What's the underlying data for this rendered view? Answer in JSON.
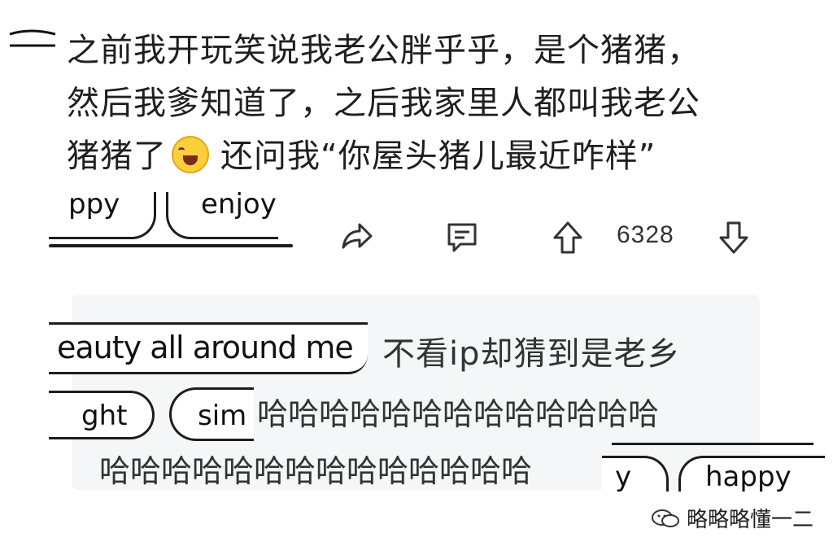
{
  "post": {
    "lines": [
      "之前我开玩笑说我老公胖乎乎，是个猪猪，",
      "然后我爹知道了，之后我家里人都叫我老公",
      "猪猪了",
      "还问我“你屋头猪儿最近咋样”"
    ],
    "emoji": "laughing-crying-emoji"
  },
  "overlay_fragments": {
    "pill_a": "ppy",
    "pill_b": "enjoy",
    "pill_c": "eauty all around me",
    "pill_d": "ght",
    "pill_e": "sim",
    "pill_f": "y",
    "pill_g": "happy"
  },
  "actions": {
    "share_icon": "share-icon",
    "comment_icon": "comment-icon",
    "upvote_icon": "upvote-icon",
    "downvote_icon": "downvote-icon",
    "vote_count": "6328"
  },
  "reply": {
    "line1": "不看ip却猜到是老乡",
    "line2": "哈哈哈哈哈哈哈哈哈哈哈哈哈",
    "line3": "哈哈哈哈哈哈哈哈哈哈哈哈哈哈"
  },
  "watermark": {
    "icon": "wechat-icon",
    "text": "略略略懂一二"
  },
  "colors": {
    "text": "#1f1f1f",
    "card_bg": "#f5f6f8",
    "emoji": "#f9cf3a"
  }
}
